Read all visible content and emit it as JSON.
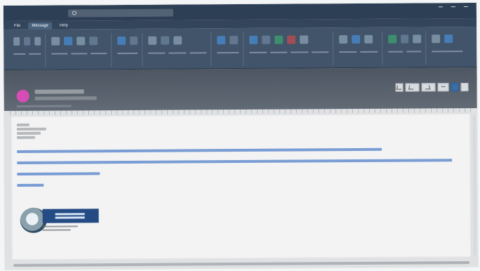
{
  "app": {
    "title": "",
    "search_label": "",
    "tabs": [
      "File",
      "Message",
      "Help"
    ]
  },
  "ribbon": {
    "groups": [
      {
        "label": ""
      },
      {
        "label": ""
      },
      {
        "label": ""
      },
      {
        "label": ""
      },
      {
        "label": ""
      },
      {
        "label": ""
      },
      {
        "label": ""
      },
      {
        "label": ""
      },
      {
        "label": ""
      }
    ]
  },
  "message": {
    "subject": "",
    "date": "",
    "actions": {
      "reply": "",
      "reply_all": "",
      "forward": ""
    }
  },
  "colors": {
    "ribbon": "#41546a",
    "header": "#4d5662",
    "avatar": "#d64db5",
    "accent": "#3a6ea8"
  },
  "icons": [
    "search-icon",
    "reply-icon",
    "reply-all-icon",
    "forward-icon",
    "more-icon"
  ]
}
